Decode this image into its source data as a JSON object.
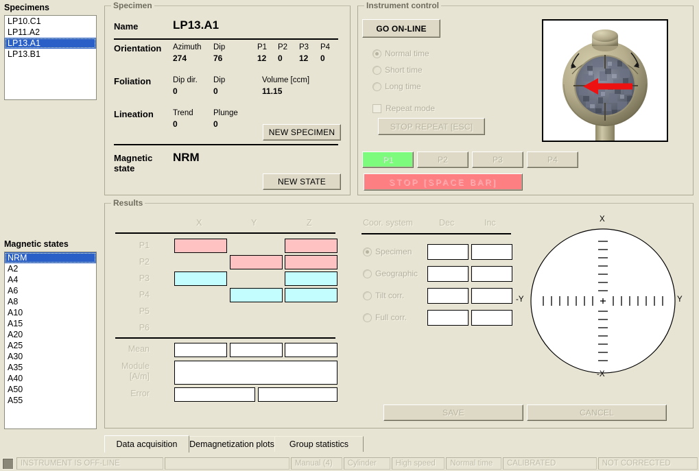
{
  "specimens_panel": {
    "title": "Specimens",
    "items": [
      {
        "label": "LP10.C1",
        "selected": false
      },
      {
        "label": "LP11.A2",
        "selected": false
      },
      {
        "label": "LP13.A1",
        "selected": true
      },
      {
        "label": "LP13.B1",
        "selected": false
      }
    ]
  },
  "magnetic_states_panel": {
    "title": "Magnetic states",
    "items": [
      {
        "label": "NRM",
        "selected": true
      },
      {
        "label": "A2",
        "selected": false
      },
      {
        "label": "A4",
        "selected": false
      },
      {
        "label": "A6",
        "selected": false
      },
      {
        "label": "A8",
        "selected": false
      },
      {
        "label": "A10",
        "selected": false
      },
      {
        "label": "A15",
        "selected": false
      },
      {
        "label": "A20",
        "selected": false
      },
      {
        "label": "A25",
        "selected": false
      },
      {
        "label": "A30",
        "selected": false
      },
      {
        "label": "A35",
        "selected": false
      },
      {
        "label": "A40",
        "selected": false
      },
      {
        "label": "A50",
        "selected": false
      },
      {
        "label": "A55",
        "selected": false
      }
    ]
  },
  "specimen": {
    "group_title": "Specimen",
    "name_label": "Name",
    "name_value": "LP13.A1",
    "orientation_label": "Orientation",
    "orientation_fields": [
      {
        "name": "Azimuth",
        "value": "274"
      },
      {
        "name": "Dip",
        "value": "76"
      },
      {
        "name": "P1",
        "value": "12"
      },
      {
        "name": "P2",
        "value": "0"
      },
      {
        "name": "P3",
        "value": "12"
      },
      {
        "name": "P4",
        "value": "0"
      }
    ],
    "foliation_label": "Foliation",
    "foliation_fields": [
      {
        "name": "Dip dir.",
        "value": "0"
      },
      {
        "name": "Dip",
        "value": "0"
      },
      {
        "name": "Volume [ccm]",
        "value": "11.15"
      }
    ],
    "lineation_label": "Lineation",
    "lineation_fields": [
      {
        "name": "Trend",
        "value": "0"
      },
      {
        "name": "Plunge",
        "value": "0"
      }
    ],
    "new_specimen_button": "NEW SPECIMEN",
    "magnetic_state_label_line1": "Magnetic",
    "magnetic_state_label_line2": "state",
    "magnetic_state_value": "NRM",
    "new_state_button": "NEW STATE"
  },
  "instrument_control": {
    "group_title": "Instrument control",
    "go_online_button": "GO ON-LINE",
    "time_options": [
      {
        "label": "Normal time",
        "selected": true
      },
      {
        "label": "Short time",
        "selected": false
      },
      {
        "label": "Long time",
        "selected": false
      }
    ],
    "repeat_mode_label": "Repeat mode",
    "repeat_mode_checked": false,
    "stop_repeat_button": "STOP REPEAT [ESC]",
    "position_buttons": [
      {
        "label": "P1",
        "active": true
      },
      {
        "label": "P2",
        "active": false
      },
      {
        "label": "P3",
        "active": false
      },
      {
        "label": "P4",
        "active": false
      }
    ],
    "stop_button": "STOP [SPACE BAR]",
    "picture_name": "specimen-holder-illustration"
  },
  "results": {
    "group_title": "Results",
    "columns": [
      "X",
      "Y",
      "Z"
    ],
    "rows": [
      {
        "label": "P1",
        "cells": [
          "pink",
          "none",
          "pink"
        ]
      },
      {
        "label": "P2",
        "cells": [
          "none",
          "pink",
          "pink"
        ]
      },
      {
        "label": "P3",
        "cells": [
          "cyan",
          "none",
          "cyan"
        ]
      },
      {
        "label": "P4",
        "cells": [
          "none",
          "cyan",
          "cyan"
        ]
      },
      {
        "label": "P5",
        "cells": [
          "none",
          "none",
          "none"
        ]
      },
      {
        "label": "P6",
        "cells": [
          "none",
          "none",
          "none"
        ]
      }
    ],
    "mean_label": "Mean",
    "mean_values": [
      "",
      "",
      ""
    ],
    "module_label_line1": "Module",
    "module_label_line2": "[A/m]",
    "module_value": "",
    "error_label": "Error",
    "error_values": [
      "",
      ""
    ],
    "colors": {
      "pink": "#ffc2c2",
      "cyan": "#c4fdfd"
    }
  },
  "coordinates": {
    "system_header": "Coor. system",
    "dec_header": "Dec",
    "inc_header": "Inc",
    "rows": [
      {
        "label": "Specimen",
        "selected": true,
        "dec": "",
        "inc": ""
      },
      {
        "label": "Geographic",
        "selected": false,
        "dec": "",
        "inc": ""
      },
      {
        "label": "Tilt corr.",
        "selected": false,
        "dec": "",
        "inc": ""
      },
      {
        "label": "Full corr.",
        "selected": false,
        "dec": "",
        "inc": ""
      }
    ]
  },
  "stereonet": {
    "label_top": "X",
    "label_bottom": "-X",
    "label_left": "-Y",
    "label_right": "Y",
    "center_marker": "+"
  },
  "actions": {
    "save_button": "SAVE",
    "cancel_button": "CANCEL"
  },
  "tabs": [
    {
      "label": "Data acquisition",
      "active": true
    },
    {
      "label": "Demagnetization plots",
      "active": false
    },
    {
      "label": "Group statistics",
      "active": false
    }
  ],
  "status_bar": {
    "indicator_name": "offline-indicator",
    "segments": [
      "INSTRUMENT IS OFF-LINE",
      "",
      "Manual (4)",
      "Cylinder",
      "High speed",
      "Normal time",
      "CALIBRATED",
      "NOT CORRECTED"
    ]
  }
}
